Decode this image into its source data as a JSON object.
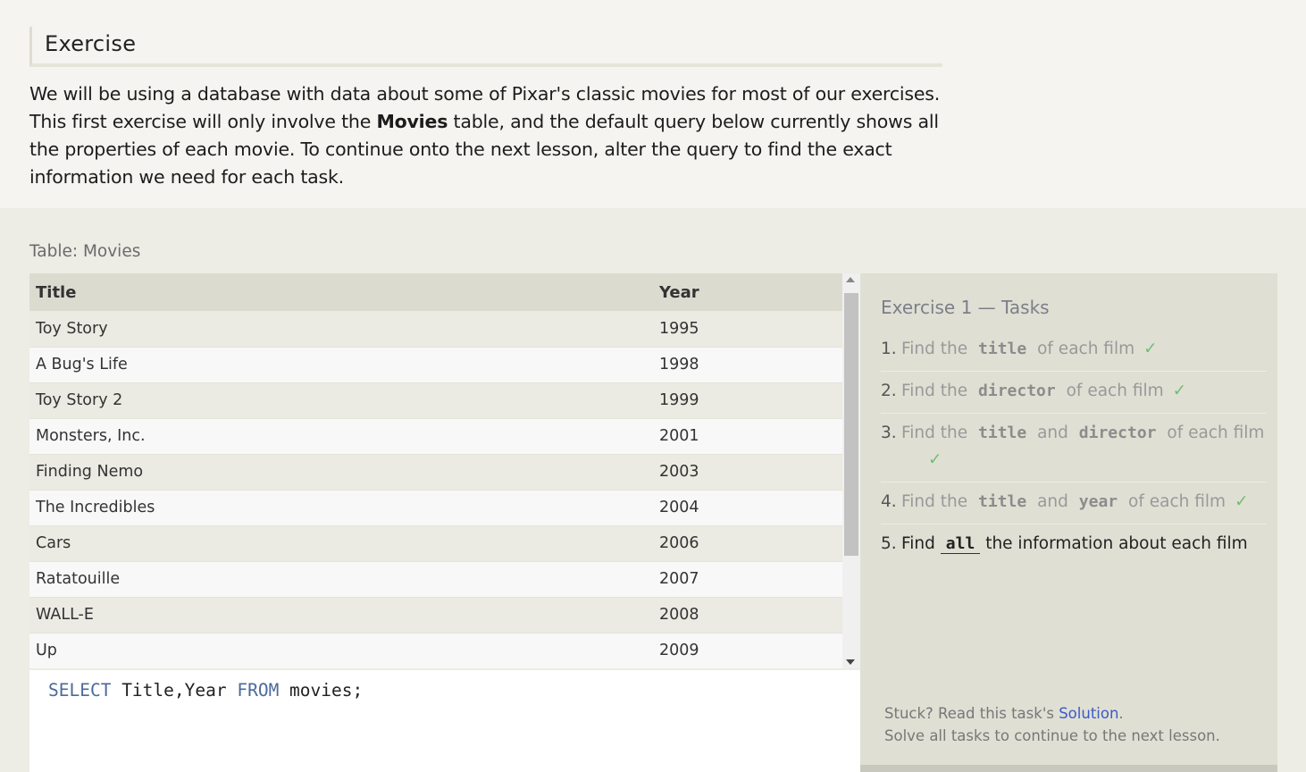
{
  "exercise": {
    "heading": "Exercise",
    "text_part1": "We will be using a database with data about some of Pixar's classic movies for most of our exercises. This first exercise will only involve the ",
    "text_bold": "Movies",
    "text_part2": " table, and the default query below currently shows all the properties of each movie. To continue onto the next lesson, alter the query to find the exact information we need for each task."
  },
  "table": {
    "caption": "Table: Movies",
    "headers": [
      "Title",
      "Year"
    ],
    "rows": [
      [
        "Toy Story",
        "1995"
      ],
      [
        "A Bug's Life",
        "1998"
      ],
      [
        "Toy Story 2",
        "1999"
      ],
      [
        "Monsters, Inc.",
        "2001"
      ],
      [
        "Finding Nemo",
        "2003"
      ],
      [
        "The Incredibles",
        "2004"
      ],
      [
        "Cars",
        "2006"
      ],
      [
        "Ratatouille",
        "2007"
      ],
      [
        "WALL-E",
        "2008"
      ],
      [
        "Up",
        "2009"
      ]
    ]
  },
  "editor": {
    "kw1": "SELECT",
    "cols": " Title,Year ",
    "kw2": "FROM",
    "rest": " movies;"
  },
  "tasks": {
    "title": "Exercise 1 — Tasks",
    "items": [
      {
        "num": "1.",
        "pre": "Find the ",
        "code1": "title",
        "mid": "",
        "code2": "",
        "post": " of each film",
        "check": "✓"
      },
      {
        "num": "2.",
        "pre": "Find the ",
        "code1": "director",
        "mid": "",
        "code2": "",
        "post": " of each film",
        "check": "✓"
      },
      {
        "num": "3.",
        "pre": "Find the ",
        "code1": "title",
        "mid": " and ",
        "code2": "director",
        "post": " of each film",
        "check": "✓"
      },
      {
        "num": "4.",
        "pre": "Find the ",
        "code1": "title",
        "mid": " and ",
        "code2": "year",
        "post": " of each film",
        "check": "✓"
      },
      {
        "num": "5.",
        "pre": "Find ",
        "code1": "all",
        "mid": "",
        "code2": "",
        "post": " the information about each film",
        "check": ""
      }
    ],
    "help_prefix": "Stuck? Read this task's ",
    "help_link": "Solution",
    "help_suffix": ".",
    "help_line2": "Solve all tasks to continue to the next lesson."
  },
  "colors": {
    "keyword": "#4b6a9c",
    "check": "#6fbf73",
    "link": "#3a5bc7"
  }
}
